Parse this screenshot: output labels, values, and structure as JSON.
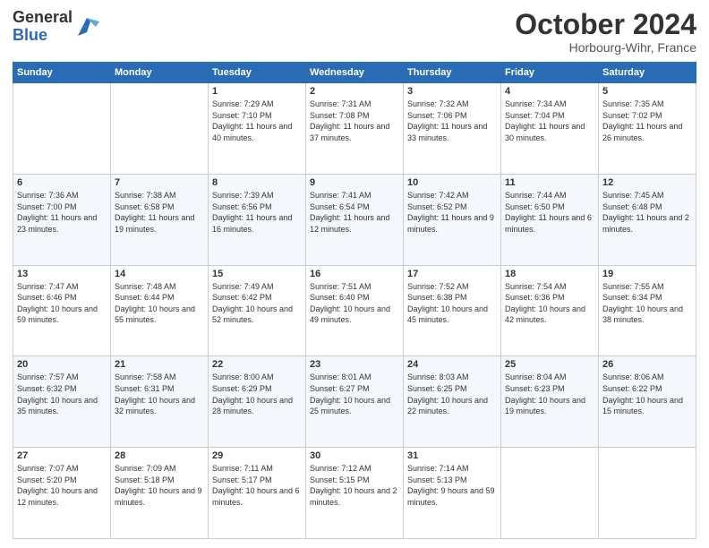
{
  "header": {
    "logo_general": "General",
    "logo_blue": "Blue",
    "title": "October 2024",
    "location": "Horbourg-Wihr, France"
  },
  "weekdays": [
    "Sunday",
    "Monday",
    "Tuesday",
    "Wednesday",
    "Thursday",
    "Friday",
    "Saturday"
  ],
  "weeks": [
    [
      {
        "day": "",
        "sunrise": "",
        "sunset": "",
        "daylight": ""
      },
      {
        "day": "",
        "sunrise": "",
        "sunset": "",
        "daylight": ""
      },
      {
        "day": "1",
        "sunrise": "Sunrise: 7:29 AM",
        "sunset": "Sunset: 7:10 PM",
        "daylight": "Daylight: 11 hours and 40 minutes."
      },
      {
        "day": "2",
        "sunrise": "Sunrise: 7:31 AM",
        "sunset": "Sunset: 7:08 PM",
        "daylight": "Daylight: 11 hours and 37 minutes."
      },
      {
        "day": "3",
        "sunrise": "Sunrise: 7:32 AM",
        "sunset": "Sunset: 7:06 PM",
        "daylight": "Daylight: 11 hours and 33 minutes."
      },
      {
        "day": "4",
        "sunrise": "Sunrise: 7:34 AM",
        "sunset": "Sunset: 7:04 PM",
        "daylight": "Daylight: 11 hours and 30 minutes."
      },
      {
        "day": "5",
        "sunrise": "Sunrise: 7:35 AM",
        "sunset": "Sunset: 7:02 PM",
        "daylight": "Daylight: 11 hours and 26 minutes."
      }
    ],
    [
      {
        "day": "6",
        "sunrise": "Sunrise: 7:36 AM",
        "sunset": "Sunset: 7:00 PM",
        "daylight": "Daylight: 11 hours and 23 minutes."
      },
      {
        "day": "7",
        "sunrise": "Sunrise: 7:38 AM",
        "sunset": "Sunset: 6:58 PM",
        "daylight": "Daylight: 11 hours and 19 minutes."
      },
      {
        "day": "8",
        "sunrise": "Sunrise: 7:39 AM",
        "sunset": "Sunset: 6:56 PM",
        "daylight": "Daylight: 11 hours and 16 minutes."
      },
      {
        "day": "9",
        "sunrise": "Sunrise: 7:41 AM",
        "sunset": "Sunset: 6:54 PM",
        "daylight": "Daylight: 11 hours and 12 minutes."
      },
      {
        "day": "10",
        "sunrise": "Sunrise: 7:42 AM",
        "sunset": "Sunset: 6:52 PM",
        "daylight": "Daylight: 11 hours and 9 minutes."
      },
      {
        "day": "11",
        "sunrise": "Sunrise: 7:44 AM",
        "sunset": "Sunset: 6:50 PM",
        "daylight": "Daylight: 11 hours and 6 minutes."
      },
      {
        "day": "12",
        "sunrise": "Sunrise: 7:45 AM",
        "sunset": "Sunset: 6:48 PM",
        "daylight": "Daylight: 11 hours and 2 minutes."
      }
    ],
    [
      {
        "day": "13",
        "sunrise": "Sunrise: 7:47 AM",
        "sunset": "Sunset: 6:46 PM",
        "daylight": "Daylight: 10 hours and 59 minutes."
      },
      {
        "day": "14",
        "sunrise": "Sunrise: 7:48 AM",
        "sunset": "Sunset: 6:44 PM",
        "daylight": "Daylight: 10 hours and 55 minutes."
      },
      {
        "day": "15",
        "sunrise": "Sunrise: 7:49 AM",
        "sunset": "Sunset: 6:42 PM",
        "daylight": "Daylight: 10 hours and 52 minutes."
      },
      {
        "day": "16",
        "sunrise": "Sunrise: 7:51 AM",
        "sunset": "Sunset: 6:40 PM",
        "daylight": "Daylight: 10 hours and 49 minutes."
      },
      {
        "day": "17",
        "sunrise": "Sunrise: 7:52 AM",
        "sunset": "Sunset: 6:38 PM",
        "daylight": "Daylight: 10 hours and 45 minutes."
      },
      {
        "day": "18",
        "sunrise": "Sunrise: 7:54 AM",
        "sunset": "Sunset: 6:36 PM",
        "daylight": "Daylight: 10 hours and 42 minutes."
      },
      {
        "day": "19",
        "sunrise": "Sunrise: 7:55 AM",
        "sunset": "Sunset: 6:34 PM",
        "daylight": "Daylight: 10 hours and 38 minutes."
      }
    ],
    [
      {
        "day": "20",
        "sunrise": "Sunrise: 7:57 AM",
        "sunset": "Sunset: 6:32 PM",
        "daylight": "Daylight: 10 hours and 35 minutes."
      },
      {
        "day": "21",
        "sunrise": "Sunrise: 7:58 AM",
        "sunset": "Sunset: 6:31 PM",
        "daylight": "Daylight: 10 hours and 32 minutes."
      },
      {
        "day": "22",
        "sunrise": "Sunrise: 8:00 AM",
        "sunset": "Sunset: 6:29 PM",
        "daylight": "Daylight: 10 hours and 28 minutes."
      },
      {
        "day": "23",
        "sunrise": "Sunrise: 8:01 AM",
        "sunset": "Sunset: 6:27 PM",
        "daylight": "Daylight: 10 hours and 25 minutes."
      },
      {
        "day": "24",
        "sunrise": "Sunrise: 8:03 AM",
        "sunset": "Sunset: 6:25 PM",
        "daylight": "Daylight: 10 hours and 22 minutes."
      },
      {
        "day": "25",
        "sunrise": "Sunrise: 8:04 AM",
        "sunset": "Sunset: 6:23 PM",
        "daylight": "Daylight: 10 hours and 19 minutes."
      },
      {
        "day": "26",
        "sunrise": "Sunrise: 8:06 AM",
        "sunset": "Sunset: 6:22 PM",
        "daylight": "Daylight: 10 hours and 15 minutes."
      }
    ],
    [
      {
        "day": "27",
        "sunrise": "Sunrise: 7:07 AM",
        "sunset": "Sunset: 5:20 PM",
        "daylight": "Daylight: 10 hours and 12 minutes."
      },
      {
        "day": "28",
        "sunrise": "Sunrise: 7:09 AM",
        "sunset": "Sunset: 5:18 PM",
        "daylight": "Daylight: 10 hours and 9 minutes."
      },
      {
        "day": "29",
        "sunrise": "Sunrise: 7:11 AM",
        "sunset": "Sunset: 5:17 PM",
        "daylight": "Daylight: 10 hours and 6 minutes."
      },
      {
        "day": "30",
        "sunrise": "Sunrise: 7:12 AM",
        "sunset": "Sunset: 5:15 PM",
        "daylight": "Daylight: 10 hours and 2 minutes."
      },
      {
        "day": "31",
        "sunrise": "Sunrise: 7:14 AM",
        "sunset": "Sunset: 5:13 PM",
        "daylight": "Daylight: 9 hours and 59 minutes."
      },
      {
        "day": "",
        "sunrise": "",
        "sunset": "",
        "daylight": ""
      },
      {
        "day": "",
        "sunrise": "",
        "sunset": "",
        "daylight": ""
      }
    ]
  ]
}
